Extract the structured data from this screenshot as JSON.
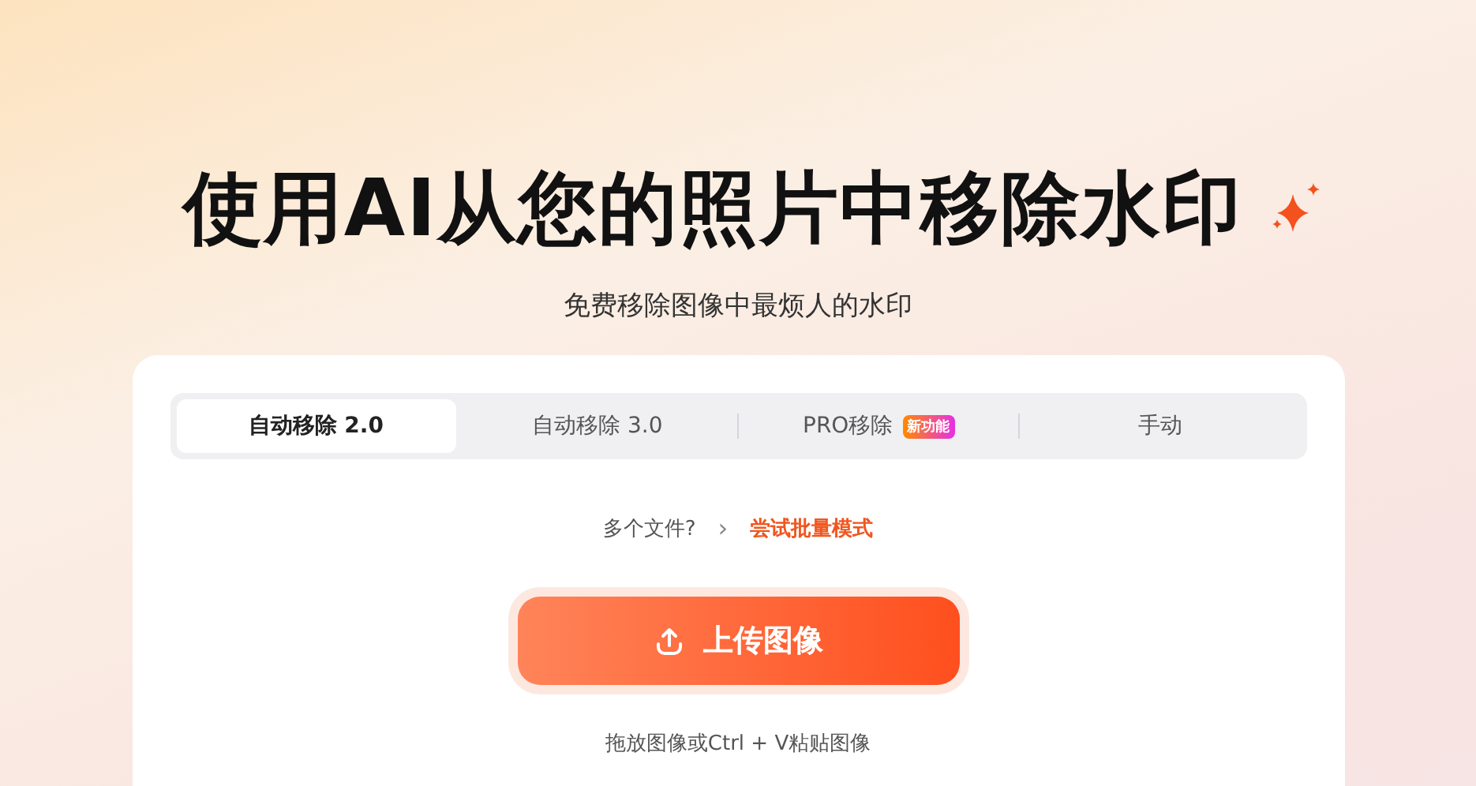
{
  "title": "使用AI从您的照片中移除水印",
  "subtitle": "免费移除图像中最烦人的水印",
  "tabs": [
    {
      "label": "自动移除 2.0",
      "selected": true
    },
    {
      "label": "自动移除 3.0",
      "selected": false
    },
    {
      "label": "PRO移除",
      "selected": false,
      "badge": "新功能"
    },
    {
      "label": "手动",
      "selected": false
    }
  ],
  "batch": {
    "question": "多个文件?",
    "chevron": "›",
    "link": "尝试批量模式"
  },
  "upload_button": "上传图像",
  "hint": "拖放图像或Ctrl + V粘贴图像"
}
